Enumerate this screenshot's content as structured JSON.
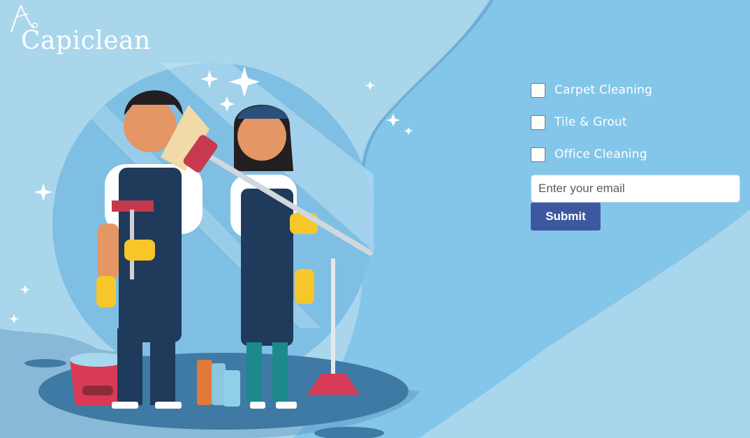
{
  "brand": {
    "name": "Capiclean"
  },
  "colors": {
    "page_bg": "#a9d4ea",
    "accent_wave": "#84c7ea",
    "button": "#3e58a0",
    "text_light": "#ffffff"
  },
  "form": {
    "options": [
      {
        "label": "Carpet Cleaning",
        "checked": false
      },
      {
        "label": "Tile & Grout",
        "checked": false
      },
      {
        "label": "Office Cleaning",
        "checked": false
      }
    ],
    "email_placeholder": "Enter your email",
    "submit_label": "Submit"
  },
  "illustration": {
    "subject": "two cleaners with broom, squeegee, bucket and supplies",
    "icons": [
      "sparkle-icon",
      "bucket-icon",
      "plunger-icon"
    ]
  }
}
